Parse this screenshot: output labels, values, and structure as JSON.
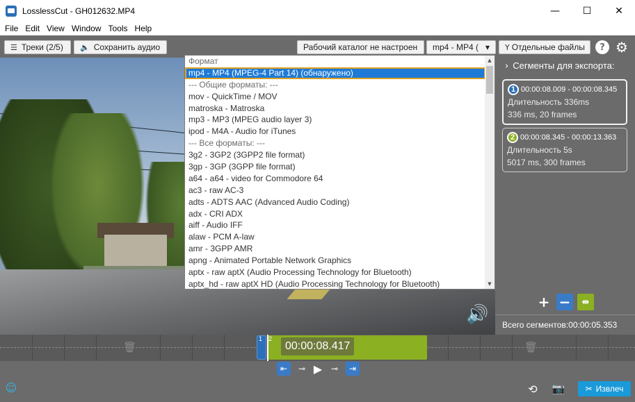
{
  "window": {
    "title": "LosslessCut - GH012632.MP4",
    "controls": {
      "minimize": "—",
      "maximize": "☐",
      "close": "✕"
    }
  },
  "menu": [
    "File",
    "Edit",
    "View",
    "Window",
    "Tools",
    "Help"
  ],
  "toolbar": {
    "tracks_label": "Треки (2/5)",
    "save_audio_label": "Сохранить аудио",
    "workdir_label": "Рабочий каталог не настроен",
    "format_select_value": "mp4 - MP4 (",
    "separate_files_label": "Отдельные файлы",
    "help_icon": "?",
    "settings_icon": "⚙"
  },
  "format_dropdown": {
    "items": [
      {
        "label": "Формат",
        "kind": "header"
      },
      {
        "label": "mp4 - MP4 (MPEG-4 Part 14) (обнаружено)",
        "kind": "selected"
      },
      {
        "label": "--- Общие форматы: ---",
        "kind": "header"
      },
      {
        "label": "mov - QuickTime / MOV",
        "kind": "item"
      },
      {
        "label": "matroska - Matroska",
        "kind": "item"
      },
      {
        "label": "mp3 - MP3 (MPEG audio layer 3)",
        "kind": "item"
      },
      {
        "label": "ipod - M4A - Audio for iTunes",
        "kind": "item"
      },
      {
        "label": "--- Все форматы: ---",
        "kind": "header"
      },
      {
        "label": "3g2 - 3GP2 (3GPP2 file format)",
        "kind": "item"
      },
      {
        "label": "3gp - 3GP (3GPP file format)",
        "kind": "item"
      },
      {
        "label": "a64 - a64 - video for Commodore 64",
        "kind": "item"
      },
      {
        "label": "ac3 - raw AC-3",
        "kind": "item"
      },
      {
        "label": "adts - ADTS AAC (Advanced Audio Coding)",
        "kind": "item"
      },
      {
        "label": "adx - CRI ADX",
        "kind": "item"
      },
      {
        "label": "aiff - Audio IFF",
        "kind": "item"
      },
      {
        "label": "alaw - PCM A-law",
        "kind": "item"
      },
      {
        "label": "amr - 3GPP AMR",
        "kind": "item"
      },
      {
        "label": "apng - Animated Portable Network Graphics",
        "kind": "item"
      },
      {
        "label": "aptx - raw aptX (Audio Processing Technology for Bluetooth)",
        "kind": "item"
      },
      {
        "label": "aptx_hd - raw aptX HD (Audio Processing Technology for Bluetooth)",
        "kind": "item"
      }
    ]
  },
  "segments_panel": {
    "title": "Сегменты для экспорта:",
    "segments": [
      {
        "num": "1",
        "range": "00:00:08.009 - 00:00:08.345",
        "duration": "Длительность 336ms",
        "detail": "336 ms, 20 frames",
        "color": "#2d6fb8"
      },
      {
        "num": "2",
        "range": "00:00:08.345 - 00:00:13.363",
        "duration": "Длительность 5s",
        "detail": "5017 ms, 300 frames",
        "color": "#8bb022"
      }
    ],
    "total": "Всего сегментов:00:00:05.353"
  },
  "timeline": {
    "current_time": "00:00:08.417",
    "seg1_num": "1",
    "seg2_num": "2"
  },
  "bottom": {
    "extract_label": "Извлеч"
  },
  "colors": {
    "accent": "#1a9ad8",
    "segment1": "#2d6fb8",
    "segment2": "#8bb022",
    "panel": "#6b6b6b"
  }
}
